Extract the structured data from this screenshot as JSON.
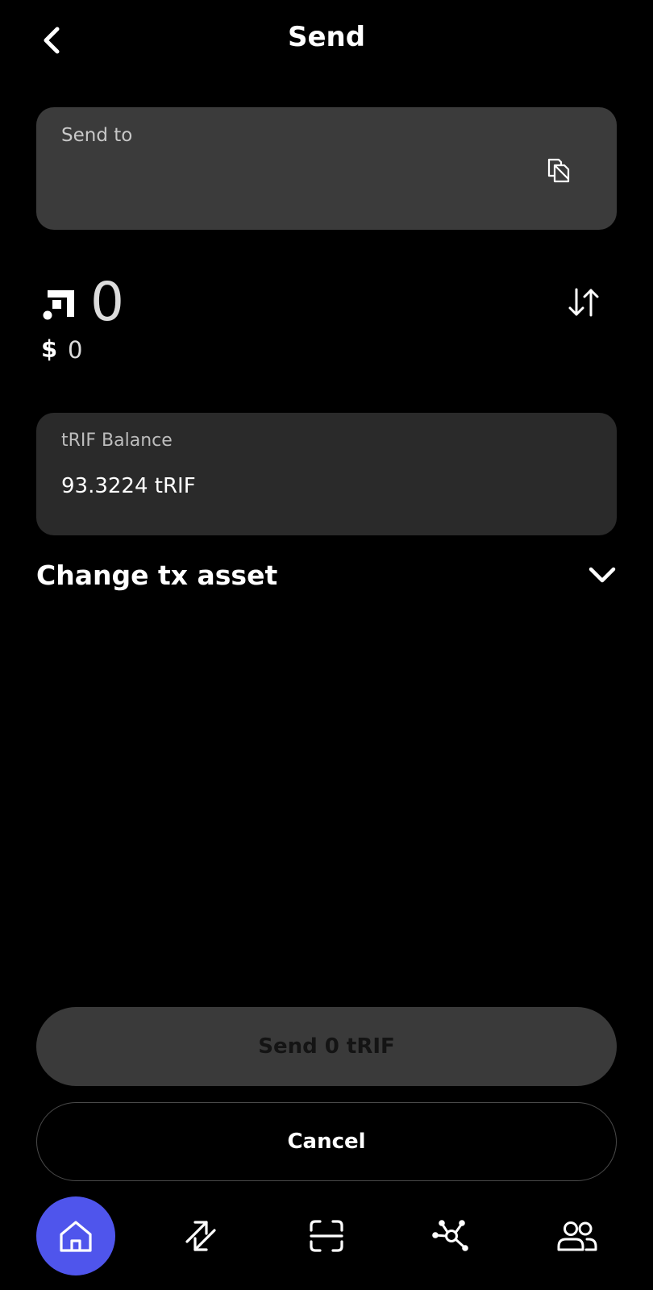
{
  "header": {
    "title": "Send",
    "back_icon": "chevron-left-icon"
  },
  "send_to": {
    "label": "Send to",
    "value": "",
    "paste_icon": "paste-icon"
  },
  "amount": {
    "token_icon": "rif-logo-icon",
    "value": "0",
    "fiat_symbol": "$",
    "fiat_value": "0",
    "swap_icon": "swap-vertical-icon"
  },
  "balance": {
    "label": "tRIF Balance",
    "value": "93.3224 tRIF"
  },
  "change_asset": {
    "label": "Change tx asset",
    "icon": "chevron-down-icon"
  },
  "actions": {
    "send_label": "Send 0 tRIF",
    "cancel_label": "Cancel"
  },
  "navbar": {
    "items": [
      {
        "icon": "home-icon",
        "active": true
      },
      {
        "icon": "send-receive-icon",
        "active": false
      },
      {
        "icon": "scan-icon",
        "active": false
      },
      {
        "icon": "network-icon",
        "active": false
      },
      {
        "icon": "contacts-icon",
        "active": false
      }
    ]
  },
  "colors": {
    "background": "#000000",
    "accent": "#4f55ec",
    "card": "#3b3b3b",
    "balance_card": "#2a2a2a"
  }
}
